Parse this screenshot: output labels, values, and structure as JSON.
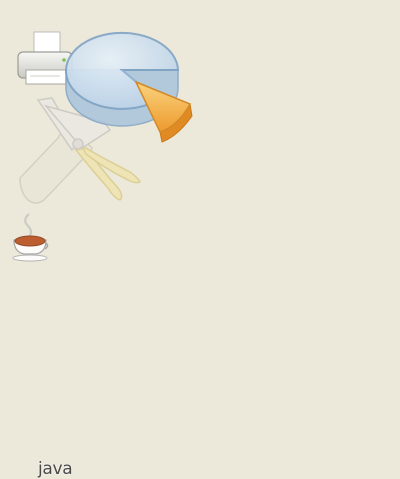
{
  "desktop": {
    "background": "#ece8da"
  },
  "icons": [
    {
      "name": "pie-chart-icon",
      "label": ""
    },
    {
      "name": "printer-icon",
      "label": ""
    },
    {
      "name": "tools-icon",
      "label": ""
    },
    {
      "name": "java-icon",
      "label": "java"
    }
  ],
  "colors": {
    "pie_blue": "#bcd4ea",
    "pie_slice": "#f4b04c",
    "java_cup": "#b8501e"
  }
}
